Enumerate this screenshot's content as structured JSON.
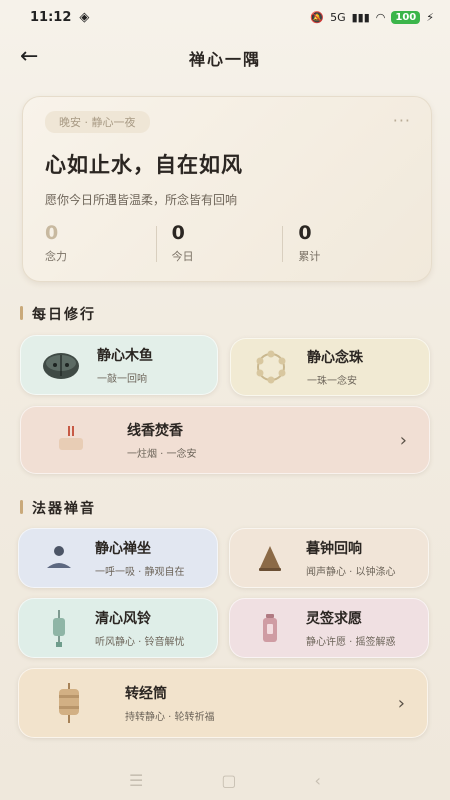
{
  "status_bar": {
    "time": "11:12",
    "signal": "5G",
    "battery": "100"
  },
  "header": {
    "title": "禅心一隅"
  },
  "hero": {
    "tag": "晚安 · 静心一夜",
    "more": "···",
    "title": "心如止水，自在如风",
    "subtitle": "愿你今日所遇皆温柔，所念皆有回响",
    "stats": [
      {
        "value": "0",
        "label": "念力"
      },
      {
        "value": "0",
        "label": "今日"
      },
      {
        "value": "0",
        "label": "累计"
      }
    ]
  },
  "section_daily": {
    "title": "每日修行",
    "items": [
      {
        "title": "静心木鱼",
        "subtitle": "一敲一回响"
      },
      {
        "title": "静心念珠",
        "subtitle": "一珠一念安"
      },
      {
        "title": "线香焚香",
        "subtitle": "一炷烟 · 一念安"
      }
    ]
  },
  "section_instruments": {
    "title": "法器禅音",
    "items": [
      {
        "title": "静心禅坐",
        "subtitle": "一呼一吸 · 静观自在"
      },
      {
        "title": "暮钟回响",
        "subtitle": "闻声静心 · 以钟涤心"
      },
      {
        "title": "清心风铃",
        "subtitle": "听风静心 · 铃音解忧"
      },
      {
        "title": "灵签求愿",
        "subtitle": "静心许愿 · 摇签解惑"
      },
      {
        "title": "转经筒",
        "subtitle": "持转静心 · 轮转祈福"
      }
    ]
  },
  "colors": {
    "wooden_fish_card": "#e3efe9",
    "beads_card": "#f1ead3",
    "incense_card": "#f1dfd4",
    "meditation_card": "#e2e7f1",
    "bell_card": "#f1e5d8",
    "wind_chime_card": "#dfeee8",
    "fortune_card": "#f0e0e2",
    "prayer_wheel_card": "#f2e3cc"
  }
}
